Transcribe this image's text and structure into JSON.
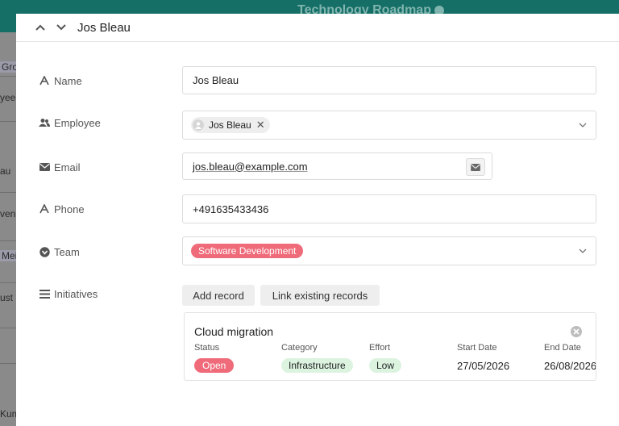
{
  "background": {
    "app_title": "Technology Roadmap",
    "cells": [
      "Gro",
      "yee",
      "au",
      "ven",
      "Meik",
      "ust",
      "Kum"
    ]
  },
  "header": {
    "title": "Jos Bleau"
  },
  "fields": {
    "name": {
      "label": "Name",
      "value": "Jos Bleau"
    },
    "employee": {
      "label": "Employee",
      "value": "Jos Bleau"
    },
    "email": {
      "label": "Email",
      "value": "jos.bleau@example.com"
    },
    "phone": {
      "label": "Phone",
      "value": "+491635433436"
    },
    "team": {
      "label": "Team",
      "value": "Software Development",
      "color": "#ef6b7a"
    },
    "initiatives": {
      "label": "Initiatives"
    }
  },
  "buttons": {
    "add_record": "Add record",
    "link_existing": "Link existing records"
  },
  "record_card": {
    "title": "Cloud migration",
    "columns": {
      "status": {
        "header": "Status",
        "value": "Open",
        "color": "#ef6b7a"
      },
      "category": {
        "header": "Category",
        "value": "Infrastructure",
        "color": "#dcf3e0"
      },
      "effort": {
        "header": "Effort",
        "value": "Low",
        "color": "#dcf3e0"
      },
      "start_date": {
        "header": "Start Date",
        "value": "27/05/2026"
      },
      "end_date": {
        "header": "End Date",
        "value": "26/08/2026"
      }
    }
  },
  "colors": {
    "header_bg": "#156f67",
    "accent_red": "#ef6b7a",
    "accent_green_bg": "#dcf3e0"
  }
}
